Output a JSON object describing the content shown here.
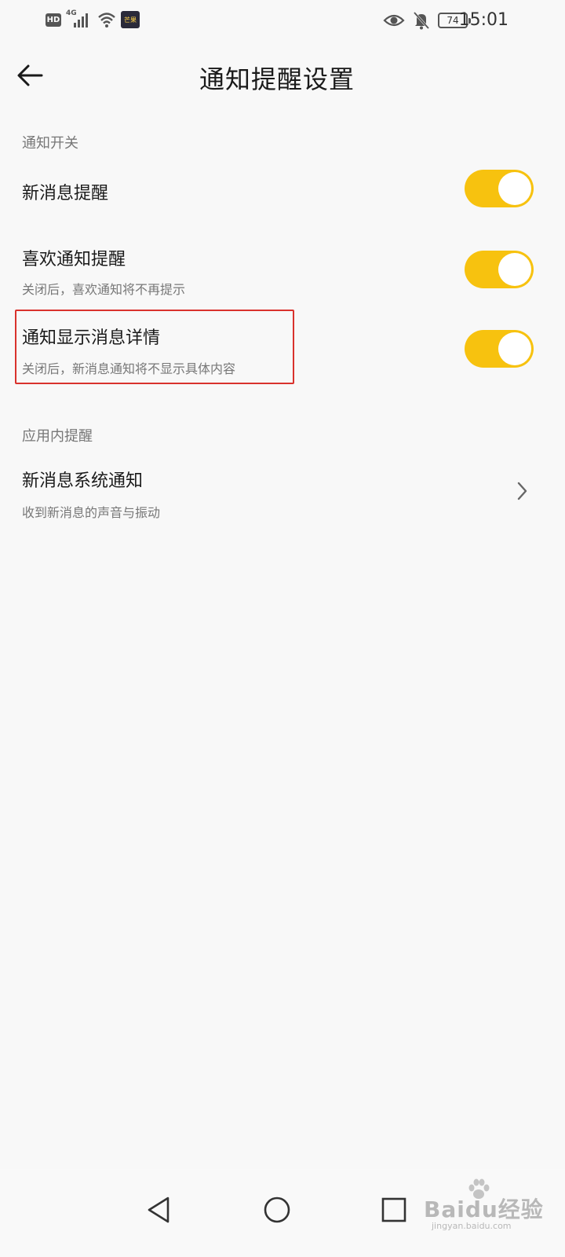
{
  "status_bar": {
    "hd": "HD",
    "network": "4G",
    "app_icon_text": "芒果",
    "battery": "74",
    "time": "15:01"
  },
  "header": {
    "title": "通知提醒设置"
  },
  "sections": [
    {
      "label": "通知开关",
      "items": [
        {
          "title": "新消息提醒",
          "subtitle": "",
          "toggle": true
        },
        {
          "title": "喜欢通知提醒",
          "subtitle": "关闭后，喜欢通知将不再提示",
          "toggle": true
        },
        {
          "title": "通知显示消息详情",
          "subtitle": "关闭后，新消息通知将不显示具体内容",
          "toggle": true
        }
      ]
    },
    {
      "label": "应用内提醒",
      "items": [
        {
          "title": "新消息系统通知",
          "subtitle": "收到新消息的声音与振动"
        }
      ]
    }
  ],
  "colors": {
    "toggle_on": "#f7c20f",
    "highlight": "#d9322d",
    "background": "#f8f8f8"
  },
  "watermark": {
    "main": "Baidu经验",
    "sub": "jingyan.baidu.com"
  }
}
